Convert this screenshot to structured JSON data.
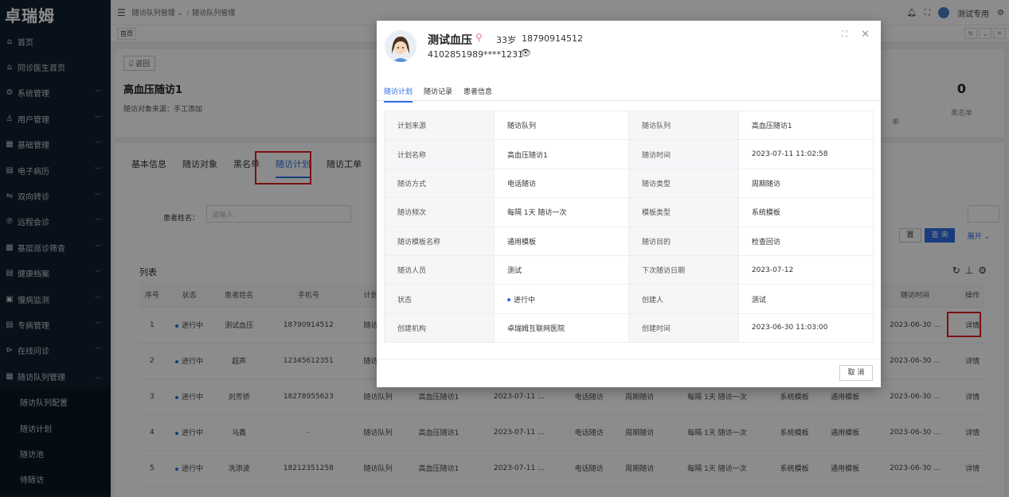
{
  "brand": "卓瑞姆",
  "sidebar": {
    "items": [
      {
        "icon": "home-icon",
        "glyph": "⌂",
        "label": "首页",
        "chev": false
      },
      {
        "icon": "home-icon",
        "glyph": "⌂",
        "label": "同诊医生首页",
        "chev": false
      },
      {
        "icon": "gear-icon",
        "glyph": "⚙",
        "label": "系统管理",
        "chev": true
      },
      {
        "icon": "user-icon",
        "glyph": "♙",
        "label": "用户管理",
        "chev": true
      },
      {
        "icon": "grid-icon",
        "glyph": "▦",
        "label": "基础管理",
        "chev": true
      },
      {
        "icon": "record-icon",
        "glyph": "▤",
        "label": "电子病历",
        "chev": true
      },
      {
        "icon": "transfer-icon",
        "glyph": "⇋",
        "label": "双向转诊",
        "chev": true
      },
      {
        "icon": "consult-icon",
        "glyph": "℗",
        "label": "远程会诊",
        "chev": true
      },
      {
        "icon": "grid-icon",
        "glyph": "▦",
        "label": "基层巡诊筛查",
        "chev": true
      },
      {
        "icon": "file-icon",
        "glyph": "▤",
        "label": "健康档案",
        "chev": true
      },
      {
        "icon": "monitor-icon",
        "glyph": "▣",
        "label": "慢病监测",
        "chev": true
      },
      {
        "icon": "disease-icon",
        "glyph": "▤",
        "label": "专病管理",
        "chev": true
      },
      {
        "icon": "play-icon",
        "glyph": "⊳",
        "label": "在线问诊",
        "chev": true
      },
      {
        "icon": "grid-icon",
        "glyph": "▦",
        "label": "随访队列管理",
        "chev": true,
        "open": true
      }
    ],
    "subitems": [
      "随访队列配置",
      "随访计划",
      "随访池",
      "待随访"
    ]
  },
  "topbar": {
    "crumb1": "随访队列管理",
    "crumb2": "随访队列管理",
    "user": "测试专用"
  },
  "tag_home": "首页",
  "detail": {
    "back_label": "返回",
    "title": "高血压随访1",
    "source": "随访对象来源：手工添加",
    "stat_value": "0",
    "stat_label": "黑名单",
    "stat_left_label": "单"
  },
  "tabs": [
    "基本信息",
    "随访对象",
    "黑名单",
    "随访计划",
    "随访工单"
  ],
  "active_tab": 3,
  "search": {
    "label": "患者姓名：",
    "placeholder": "请输入",
    "reset": "置",
    "query": "查 询",
    "expand": "展开"
  },
  "list_title": "列表",
  "table": {
    "headers": [
      "序号",
      "状态",
      "患者姓名",
      "手机号",
      "计划来源",
      "",
      "",
      "",
      "",
      "",
      "",
      "",
      "随访时间",
      "操作"
    ],
    "rows": [
      [
        "1",
        "进行中",
        "测试血压",
        "18790914512",
        "随访队列",
        "",
        "",
        "",
        "",
        "",
        "",
        "",
        "2023-06-30 ...",
        "详情"
      ],
      [
        "2",
        "进行中",
        "超声",
        "12345612351",
        "随访队列",
        "",
        "",
        "",
        "",
        "",
        "",
        "",
        "2023-06-30 ...",
        "详情"
      ],
      [
        "3",
        "进行中",
        "刘芳骄",
        "18278955623",
        "随访队列",
        "高血压随访1",
        "2023-07-11 ...",
        "电话随访",
        "周期随访",
        "每隔 1天 随访一次",
        "系统模板",
        "通用模板",
        "2023-06-30 ...",
        "详情"
      ],
      [
        "4",
        "进行中",
        "马鑫",
        "-",
        "随访队列",
        "高血压随访1",
        "2023-07-11 ...",
        "电话随访",
        "周期随访",
        "每隔 1天 随访一次",
        "系统模板",
        "通用模板",
        "2023-06-30 ...",
        "详情"
      ],
      [
        "5",
        "进行中",
        "冼添波",
        "18212351258",
        "随访队列",
        "高血压随访1",
        "2023-07-11 ...",
        "电话随访",
        "周期随访",
        "每隔 1天 随访一次",
        "系统模板",
        "通用模板",
        "2023-06-30 ...",
        "详情"
      ]
    ]
  },
  "modal": {
    "name": "测试血压",
    "age": "33岁",
    "phone": "18790914512",
    "id_number": "4102851989****1231",
    "tabs": [
      "随访计划",
      "随访记录",
      "患者信息"
    ],
    "rows": [
      [
        "计划来源",
        "随访队列",
        "随访队列",
        "高血压随访1"
      ],
      [
        "计划名称",
        "高血压随访1",
        "随访时间",
        "2023-07-11 11:02:58"
      ],
      [
        "随访方式",
        "电话随访",
        "随访类型",
        "周期随访"
      ],
      [
        "随访频次",
        "每隔 1天 随访一次",
        "模板类型",
        "系统模板"
      ],
      [
        "随访模板名称",
        "通用模板",
        "随访目的",
        "检查回访"
      ],
      [
        "随访人员",
        "测试",
        "下次随访日期",
        "2023-07-12"
      ],
      [
        "状态",
        "进行中",
        "创建人",
        "测试"
      ],
      [
        "创建机构",
        "卓瑞姆互联网医院",
        "创建时间",
        "2023-06-30 11:03:00"
      ]
    ],
    "cancel": "取 消"
  },
  "colors": {
    "primary": "#2f6ee8",
    "sidebar": "#0f1e2e",
    "highlight": "#e02020"
  }
}
